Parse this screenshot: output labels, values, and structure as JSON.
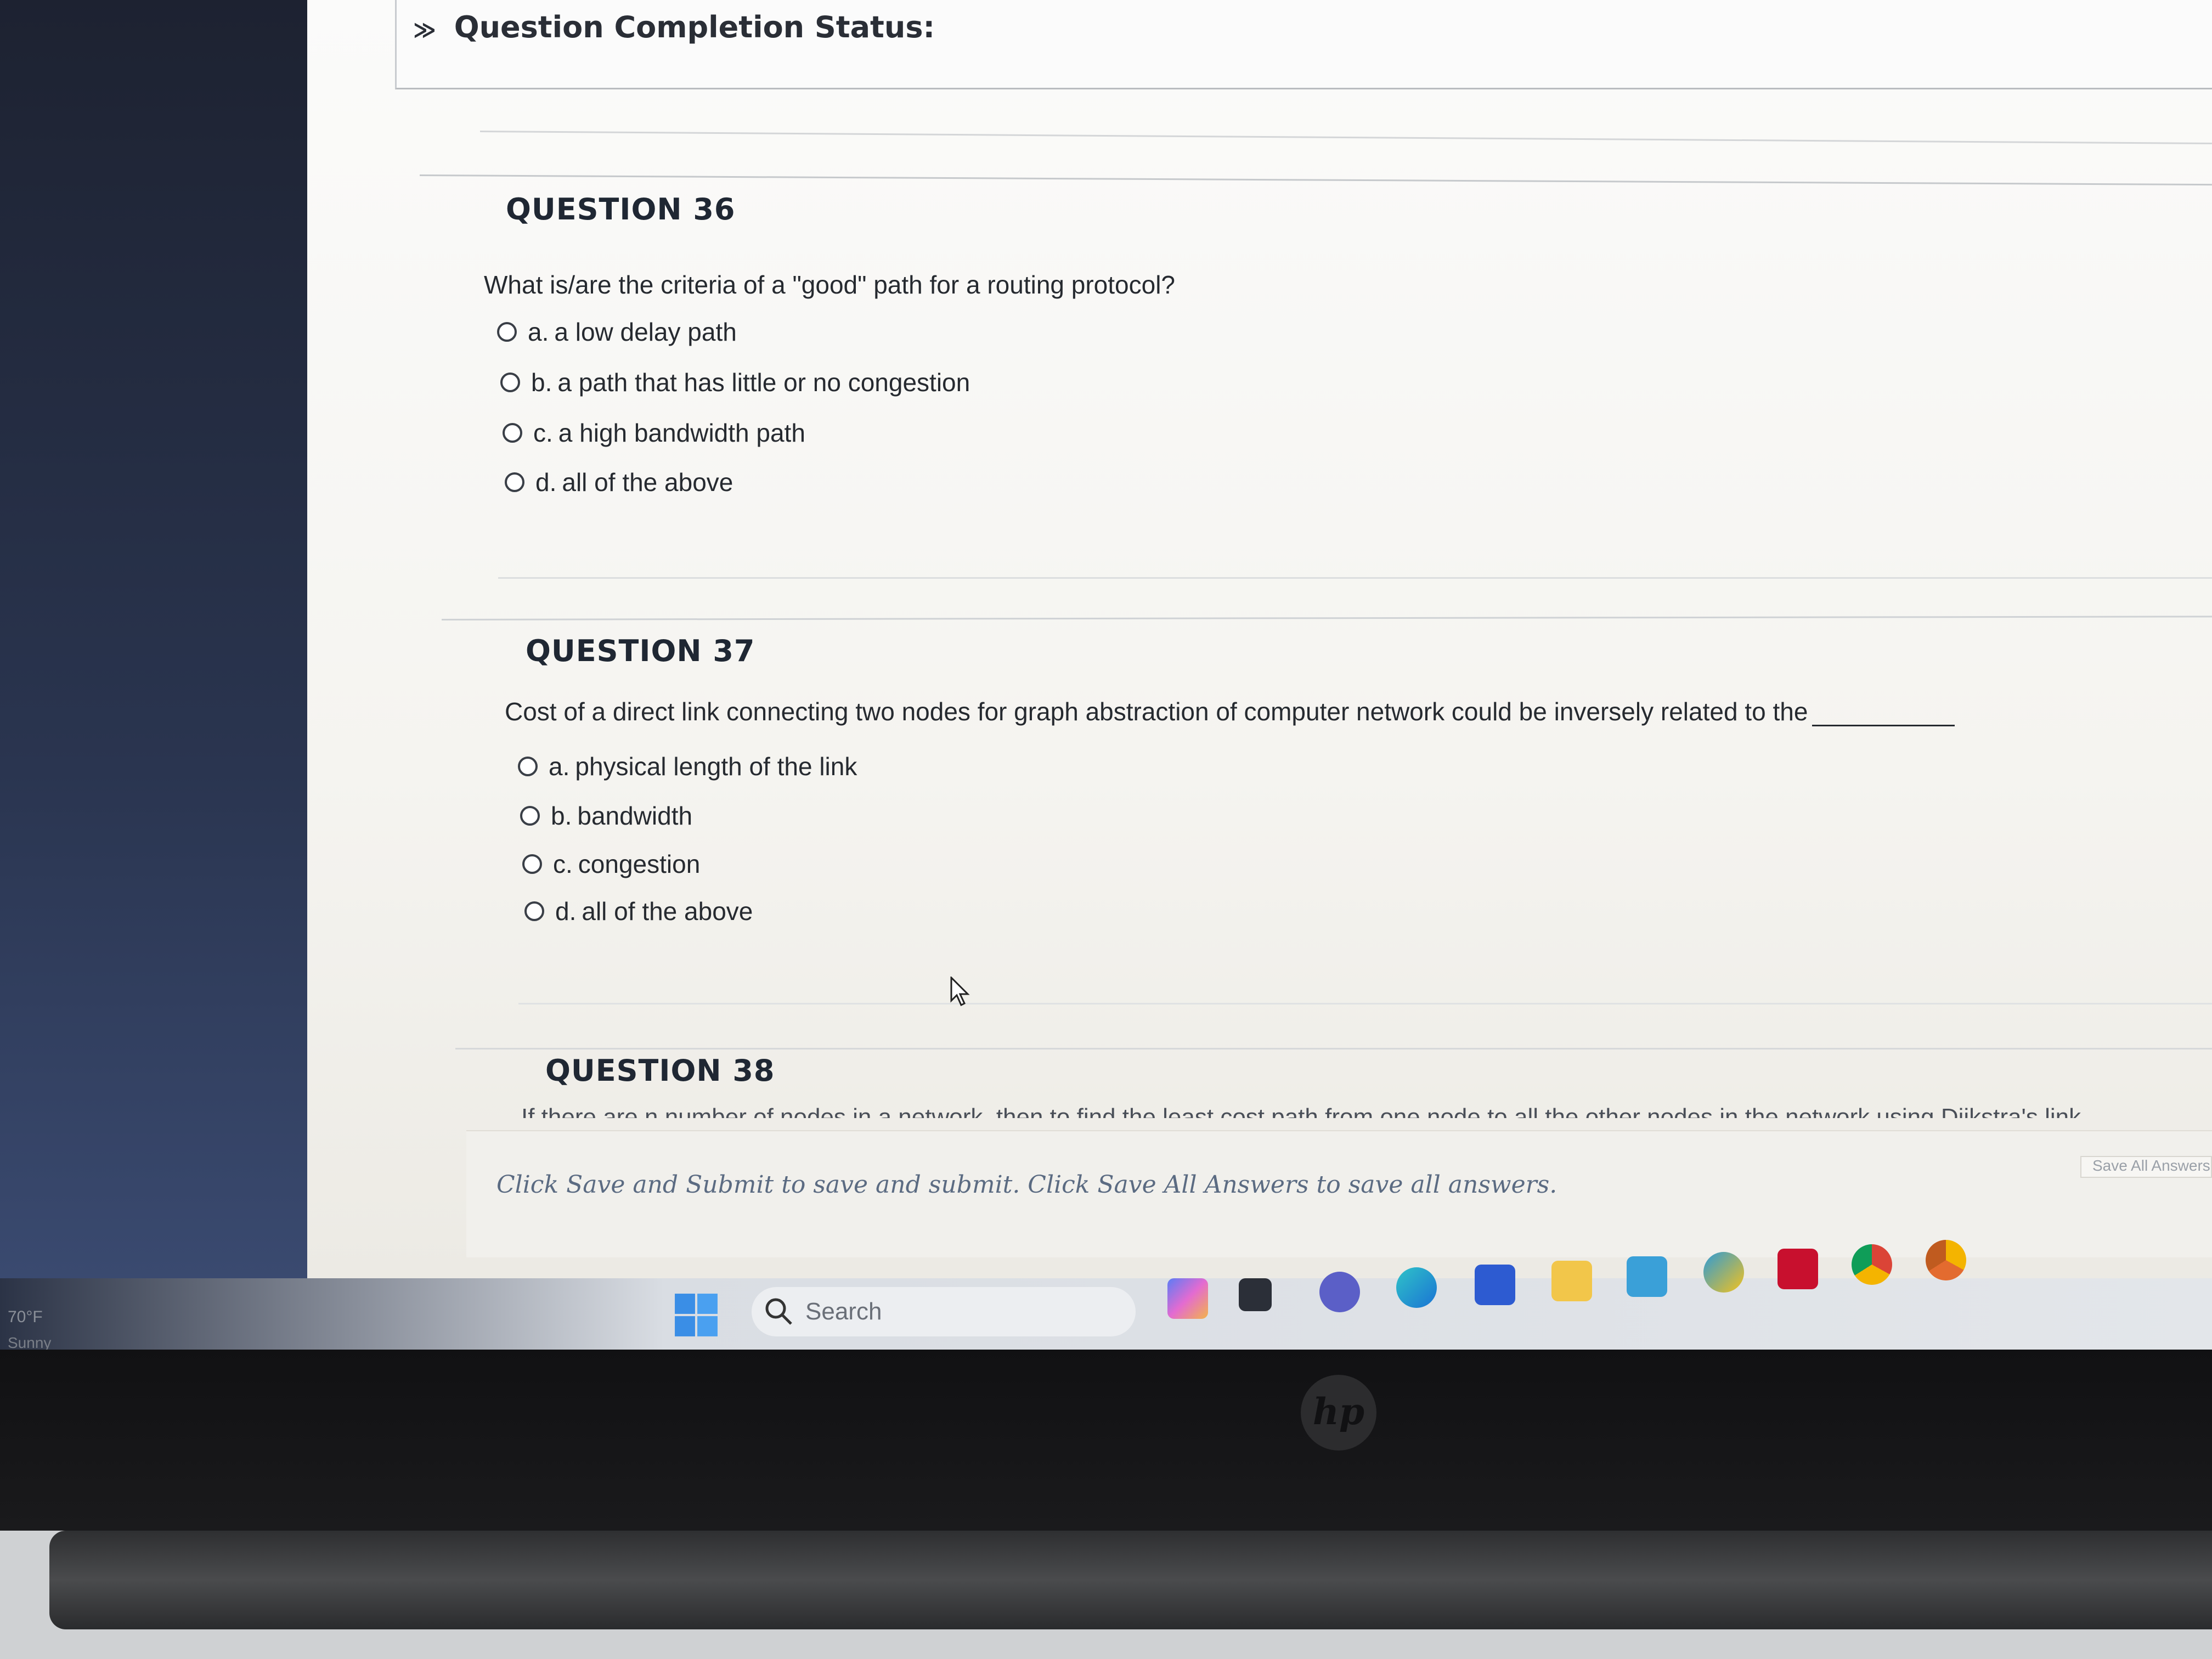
{
  "status": {
    "chevron": "≫",
    "title": "Question Completion Status:"
  },
  "questions": [
    {
      "heading": "QUESTION 36",
      "text": "What is/are the criteria of a \"good\" path for a routing protocol?",
      "options": [
        {
          "letter": "a.",
          "label": "a low delay path"
        },
        {
          "letter": "b.",
          "label": "a path that has little or no congestion"
        },
        {
          "letter": "c.",
          "label": "a high bandwidth path"
        },
        {
          "letter": "d.",
          "label": "all of the above"
        }
      ]
    },
    {
      "heading": "QUESTION 37",
      "text": "Cost of a direct link connecting two nodes for graph abstraction of computer network could be inversely related to the",
      "options": [
        {
          "letter": "a.",
          "label": "physical length of the link"
        },
        {
          "letter": "b.",
          "label": "bandwidth"
        },
        {
          "letter": "c.",
          "label": "congestion"
        },
        {
          "letter": "d.",
          "label": "all of the above"
        }
      ]
    },
    {
      "heading": "QUESTION 38",
      "text": "If there are n number of nodes in a network, then to find the least cost path from one node to all the other nodes in the network using Dijkstra's link"
    }
  ],
  "footer": {
    "instruction": "Click Save and Submit to save and submit. Click Save All Answers to save all answers.",
    "save_all_label": "Save All Answers"
  },
  "taskbar": {
    "weather_temp": "70°F",
    "weather_desc": "Sunny",
    "search_placeholder": "Search",
    "icons": [
      "copilot-icon",
      "task-view-icon",
      "teams-icon",
      "edge-icon",
      "store-icon",
      "file-explorer-icon",
      "app-icon",
      "app-icon",
      "mcafee-icon",
      "chrome-icon",
      "chrome-canary-icon"
    ]
  },
  "device": {
    "logo_text": "hp"
  },
  "colors": {
    "accent_footer_text": "#5b6b82",
    "page_bg": "#f7f6f2",
    "left_panel": "#2a3550"
  }
}
